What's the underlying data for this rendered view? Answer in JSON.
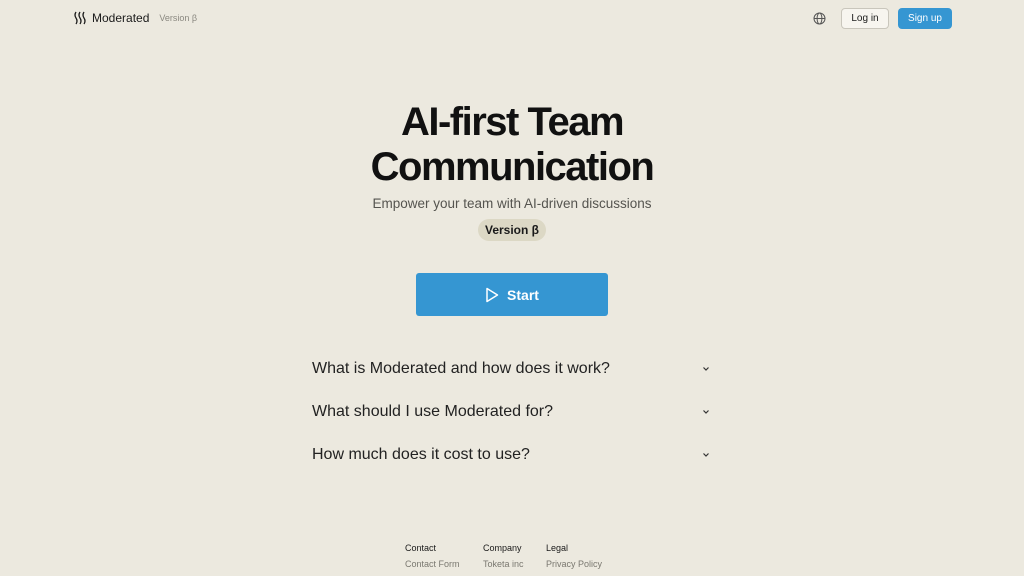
{
  "header": {
    "brand_name": "Moderated",
    "brand_version": "Version β",
    "login_label": "Log in",
    "signup_label": "Sign up"
  },
  "hero": {
    "title_line1": "AI-first Team",
    "title_line2": "Communication",
    "subtitle": "Empower your team with AI-driven discussions",
    "version_pill": "Version β",
    "start_label": "Start"
  },
  "faq": [
    {
      "question": "What is Moderated and how does it work?"
    },
    {
      "question": "What should I use Moderated for?"
    },
    {
      "question": "How much does it cost to use?"
    }
  ],
  "footer": {
    "columns": [
      {
        "heading": "Contact",
        "link": "Contact Form"
      },
      {
        "heading": "Company",
        "link": "Toketa inc"
      },
      {
        "heading": "Legal",
        "link": "Privacy Policy"
      }
    ]
  },
  "colors": {
    "background": "#ece9df",
    "accent": "#3596d2",
    "pill": "#dcd8c5"
  }
}
